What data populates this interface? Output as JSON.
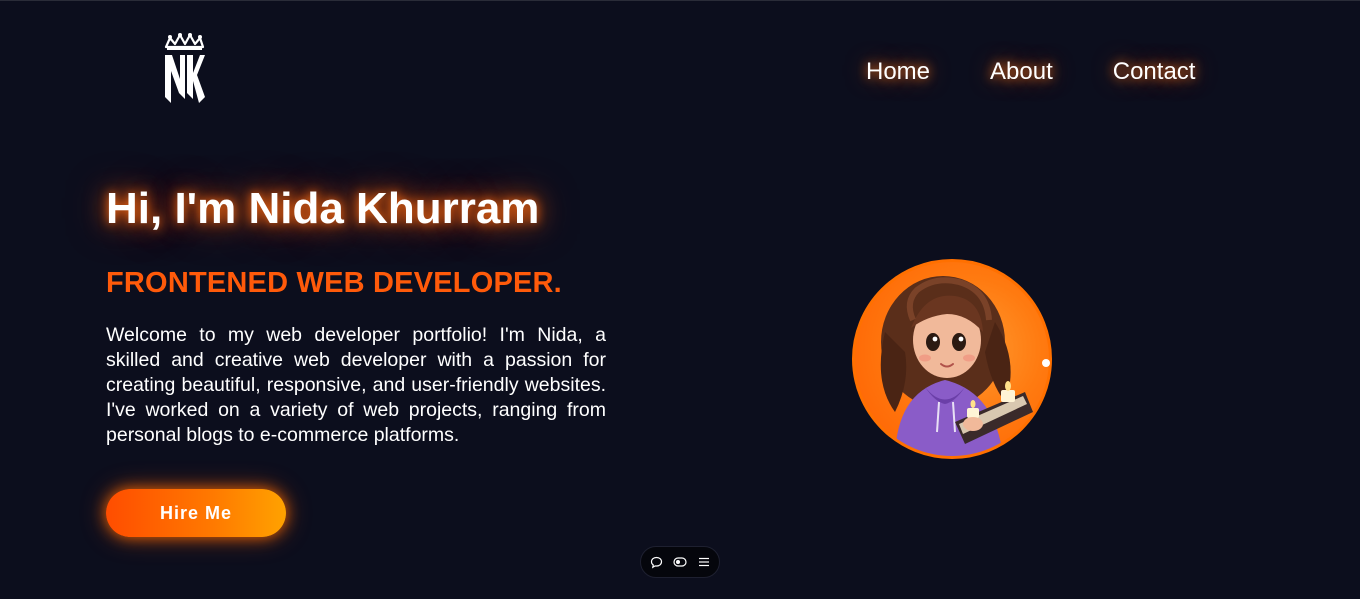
{
  "header": {
    "logo_text": "NK",
    "logo_icon": "crown-icon"
  },
  "nav": {
    "items": [
      {
        "label": "Home"
      },
      {
        "label": "About"
      },
      {
        "label": "Contact"
      }
    ]
  },
  "hero": {
    "title": "Hi, I'm Nida Khurram",
    "subtitle": "FRONTENED WEB DEVELOPER.",
    "description": "Welcome to my web developer portfolio! I'm Nida, a skilled and creative web developer with a passion for creating beautiful, responsive, and user-friendly websites. I've worked on a variety of web projects, ranging from personal blogs to e-commerce platforms.",
    "cta_label": "Hire Me"
  },
  "avatar": {
    "alt": "cartoon girl avatar"
  },
  "toolbar": {
    "icons": [
      "comment-icon",
      "toggle-icon",
      "menu-icon"
    ]
  },
  "colors": {
    "background": "#0c0e1d",
    "accent": "#ff5a0a",
    "glow": "#ff6e14",
    "text": "#ffffff"
  }
}
